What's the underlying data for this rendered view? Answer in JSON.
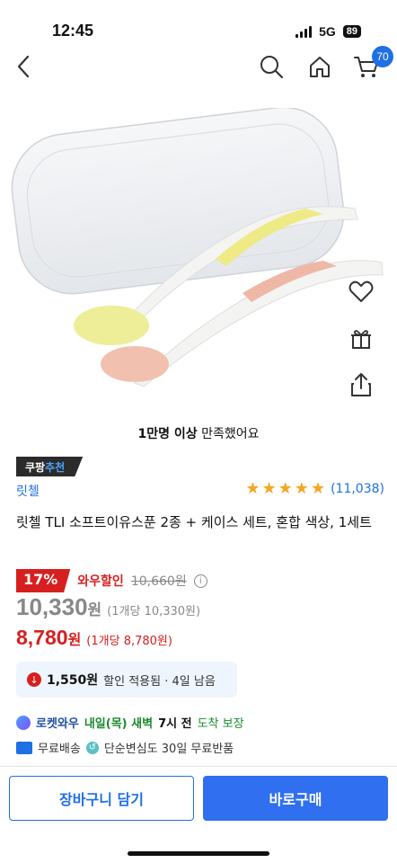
{
  "status_bar": {
    "time": "12:45",
    "network": "5G",
    "battery": "89"
  },
  "header": {
    "cart_count": "70"
  },
  "social_proof": {
    "highlight": "1만명 이상",
    "rest": " 만족했어요"
  },
  "badge": {
    "part1": "쿠팡",
    "part2": "추천"
  },
  "seller": {
    "name": "릿첼"
  },
  "rating": {
    "stars": 5,
    "count": "(11,038)"
  },
  "product": {
    "title": "릿첼 TLI 소프트이유스푼 2종 + 케이스 세트, 혼합 색상, 1세트"
  },
  "pricing": {
    "discount_percent": "17%",
    "wow_label": "와우할인",
    "original_price": "10,660원",
    "info_mark": "i",
    "sale_price": "10,330",
    "sale_price_unit": "원",
    "sale_unit_price": "(1개당 10,330원)",
    "wow_price": "8,780",
    "wow_price_unit": "원",
    "wow_unit_price": "(1개당 8,780원)"
  },
  "coupon": {
    "amount": "1,550원",
    "text": "할인 적용됨 · 4일 남음",
    "icon": "↓"
  },
  "delivery": {
    "rocket_label": "로켓와우",
    "date_part": "내일(목) 새벽",
    "time_part": "7시 전",
    "suffix": "도착 보장"
  },
  "benefits": {
    "shipping": "무료배송",
    "return_icon": "↺",
    "return": "단순변심도 30일 무료반품"
  },
  "buttons": {
    "add_to_cart": "장바구니 담기",
    "buy_now": "바로구매"
  },
  "colors": {
    "accent_blue": "#1f6fe5",
    "sale_red": "#d6201f",
    "star": "#f5a623"
  }
}
